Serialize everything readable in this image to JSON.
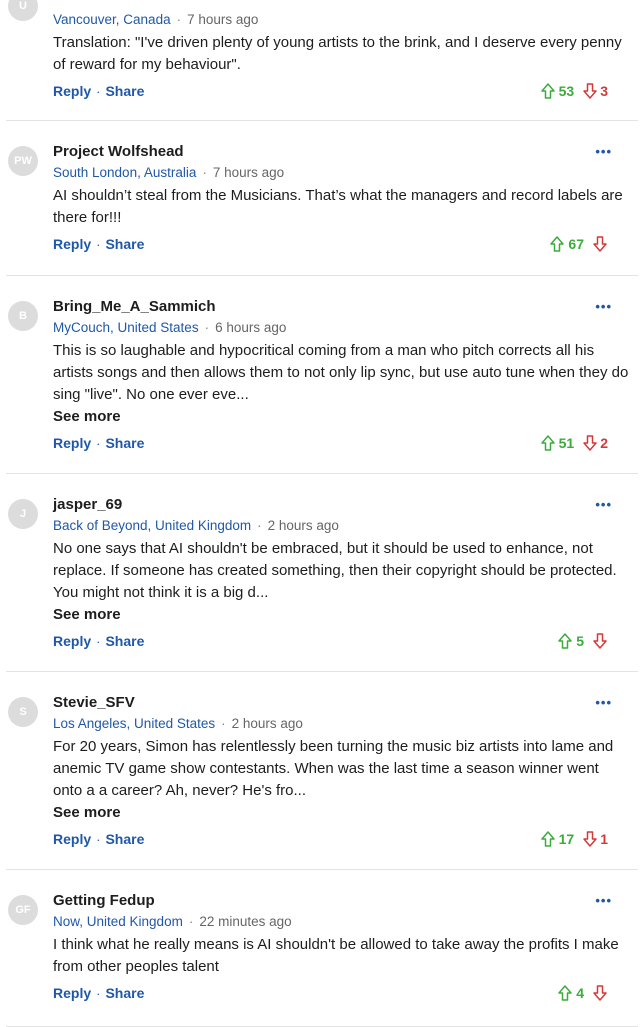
{
  "comments": [
    {
      "initials": "U",
      "name": "",
      "location": "Vancouver, Canada",
      "time": "7 hours ago",
      "text": "Translation: \"I've driven plenty of young artists to the brink, and I deserve every penny of reward for my behaviour\".",
      "see_more": "",
      "upvotes": "53",
      "downvotes": "3"
    },
    {
      "initials": "PW",
      "name": "Project Wolfshead",
      "location": "South London, Australia",
      "time": "7 hours ago",
      "text": "AI shouldn’t steal from the Musicians.  That’s what the managers and record labels are there for!!!",
      "see_more": "",
      "upvotes": "67",
      "downvotes": ""
    },
    {
      "initials": "B",
      "name": "Bring_Me_A_Sammich",
      "location": "MyCouch, United States",
      "time": "6 hours ago",
      "text": "This is so laughable and hypocritical coming from a man who pitch corrects all his artists songs and then allows them to not only lip sync, but use auto tune when they do sing \"live\". No one ever eve...",
      "see_more": "See more",
      "upvotes": "51",
      "downvotes": "2"
    },
    {
      "initials": "J",
      "name": "jasper_69",
      "location": "Back of Beyond, United Kingdom",
      "time": "2 hours ago",
      "text": "No one says that AI shouldn't be embraced, but it should be used to enhance, not replace. If someone has created something, then their copyright should be protected. You might not think it is a big d...",
      "see_more": "See more",
      "upvotes": "5",
      "downvotes": ""
    },
    {
      "initials": "S",
      "name": "Stevie_SFV",
      "location": "Los Angeles, United States",
      "time": "2 hours ago",
      "text": "For 20 years, Simon has relentlessly been turning the music biz artists into lame and anemic TV game show contestants. When was the last time a season winner went onto a a career? Ah, never? He's fro...",
      "see_more": "See more",
      "upvotes": "17",
      "downvotes": "1"
    },
    {
      "initials": "GF",
      "name": "Getting Fedup",
      "location": "Now, United Kingdom",
      "time": "22 minutes ago",
      "text": "I think what he really means is AI shouldn't be allowed to take away the profits I make from other peoples talent",
      "see_more": "",
      "upvotes": "4",
      "downvotes": ""
    }
  ],
  "labels": {
    "reply": "Reply",
    "share": "Share",
    "dot": "·",
    "sep": "·",
    "more": "•••"
  },
  "colors": {
    "link": "#2058a8",
    "upvote": "#3bab3b",
    "downvote": "#d23a3a",
    "divider": "#e3e3e3",
    "avatar_bg": "#dcdcdc"
  },
  "icons": {
    "upvote": "arrow-up-outline-icon",
    "downvote": "arrow-down-outline-icon",
    "more": "more-dots-icon"
  }
}
